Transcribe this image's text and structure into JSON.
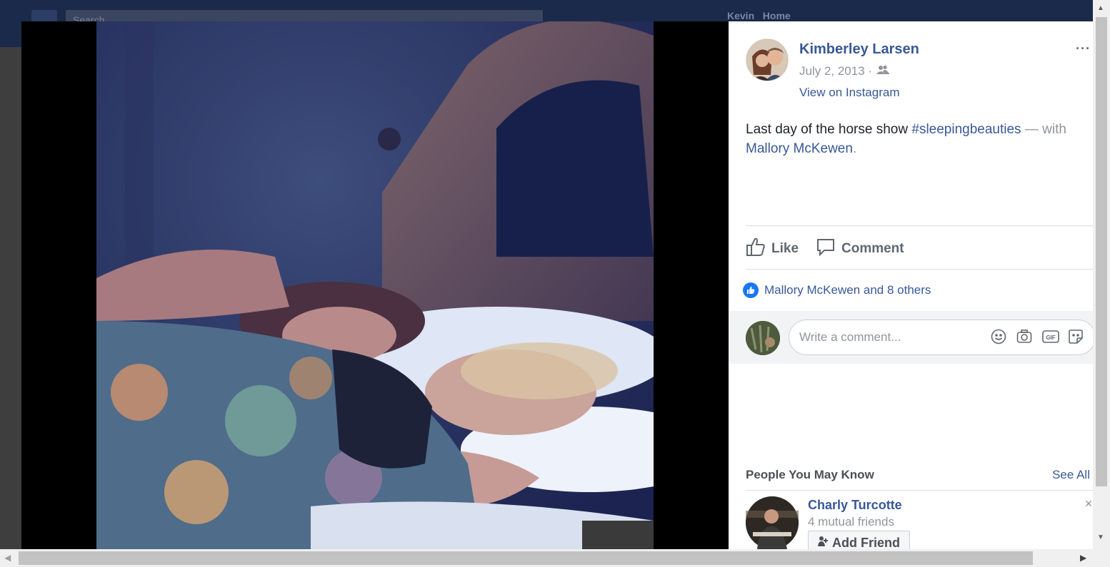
{
  "background": {
    "search_placeholder": "Search",
    "user_name": "Kevin",
    "home_label": "Home"
  },
  "post": {
    "author": "Kimberley Larsen",
    "date": "July 2, 2013 ·",
    "privacy_icon": "friends-icon",
    "view_on": "View on Instagram",
    "more": "···",
    "caption_text": "Last day of the horse show ",
    "caption_hashtag": "#sleepingbeauties",
    "caption_with": " — with ",
    "caption_tagged": "Mallory McKewen",
    "caption_end": "."
  },
  "actions": {
    "like": "Like",
    "comment": "Comment"
  },
  "reactions": {
    "summary": "Mallory McKewen and 8 others"
  },
  "comment_box": {
    "placeholder": "Write a comment...",
    "icons": [
      "emoji-icon",
      "camera-icon",
      "gif-icon",
      "sticker-icon"
    ],
    "gif_label": "GIF"
  },
  "people_you_may_know": {
    "title": "People You May Know",
    "see_all": "See All",
    "people": [
      {
        "name": "Charly Turcotte",
        "mutual": "4 mutual friends",
        "action": "Add Friend"
      }
    ]
  },
  "colors": {
    "link": "#385898",
    "muted": "#90949c",
    "like_blue": "#1877f2"
  }
}
